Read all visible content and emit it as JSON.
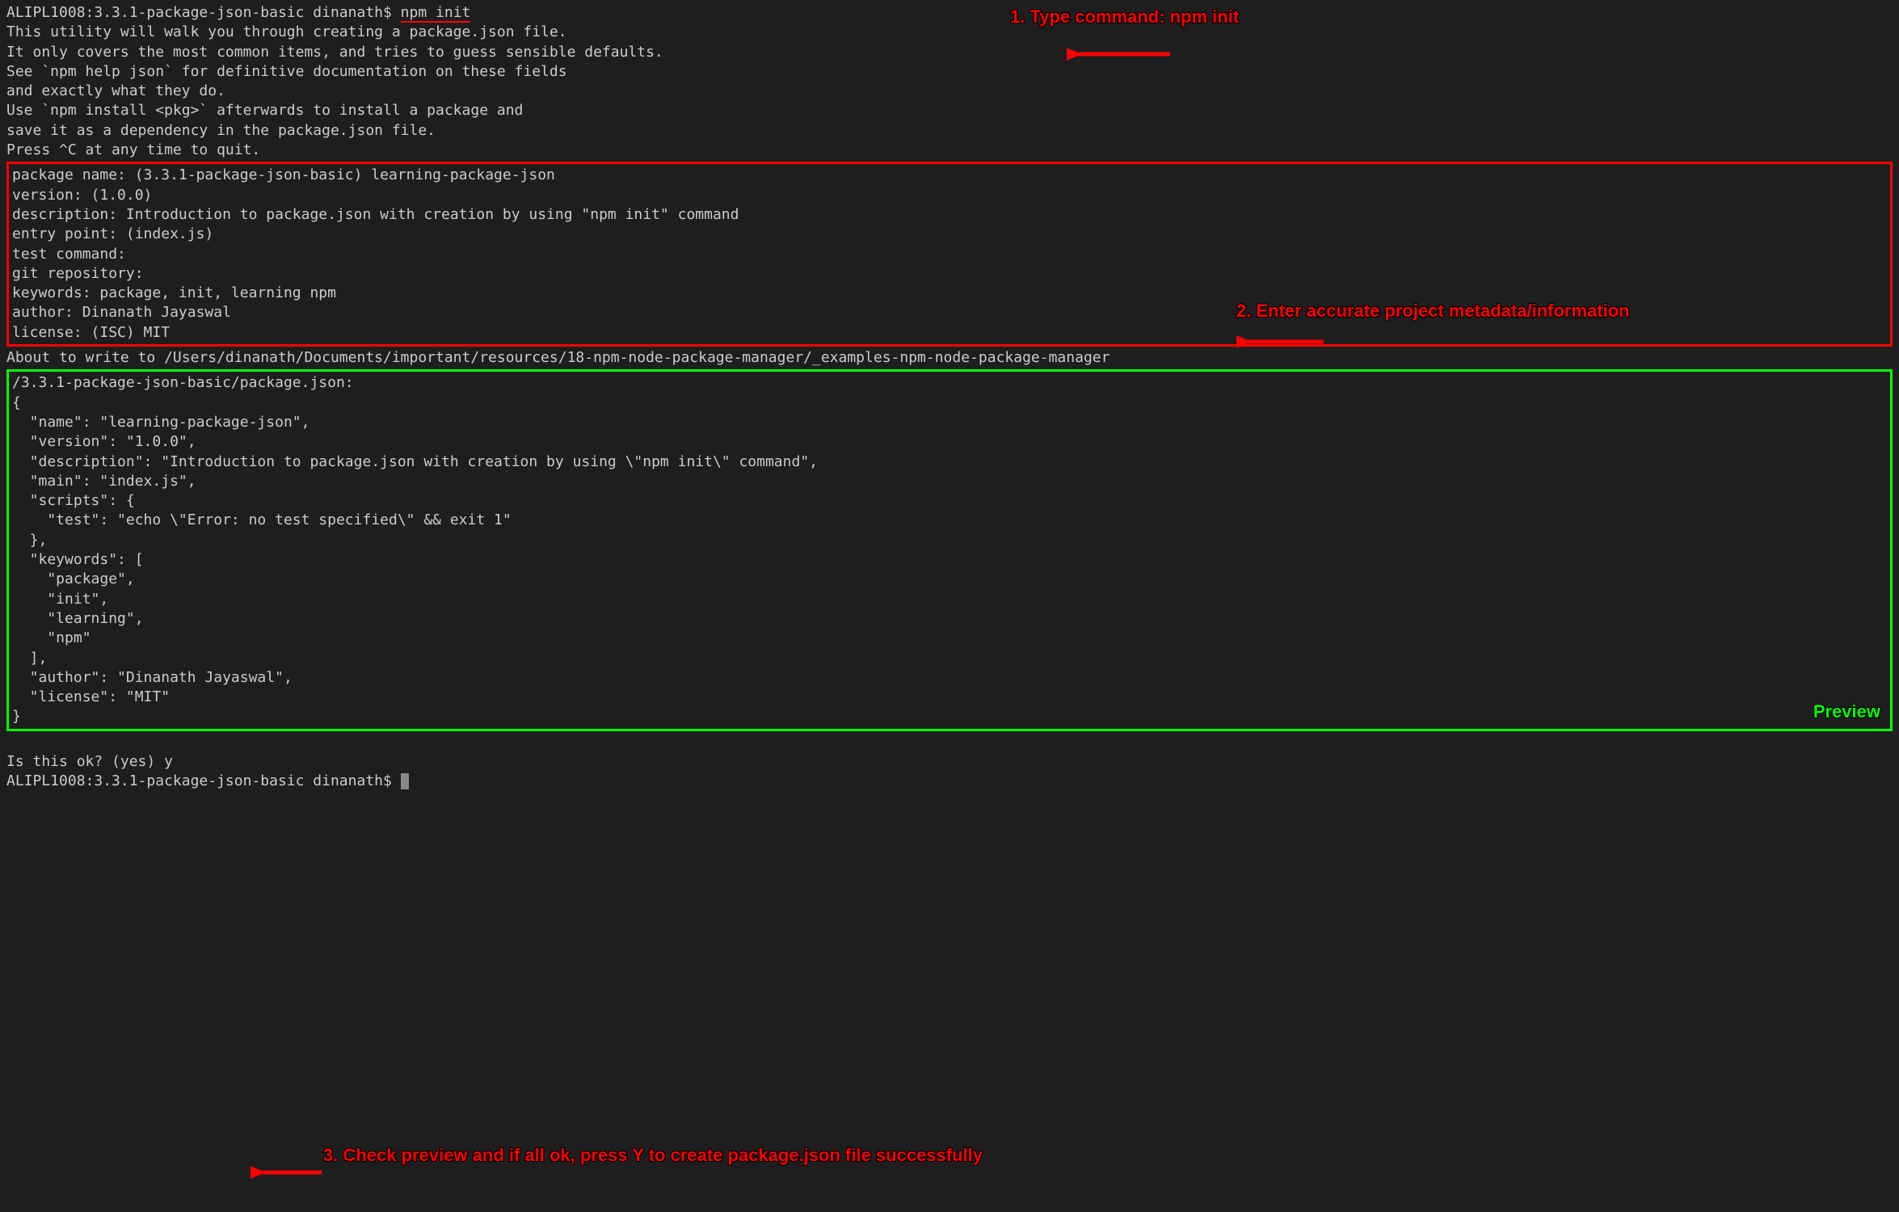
{
  "prompt": {
    "host": "ALIPL1008:3.3.1-package-json-basic dinanath$ ",
    "command": "npm init"
  },
  "intro": {
    "l1": "This utility will walk you through creating a package.json file.",
    "l2": "It only covers the most common items, and tries to guess sensible defaults.",
    "l3": "",
    "l4": "See `npm help json` for definitive documentation on these fields",
    "l5": "and exactly what they do.",
    "l6": "",
    "l7": "Use `npm install <pkg>` afterwards to install a package and",
    "l8": "save it as a dependency in the package.json file.",
    "l9": "",
    "l10": "Press ^C at any time to quit."
  },
  "meta": {
    "package_name": "package name: (3.3.1-package-json-basic) learning-package-json",
    "version": "version: (1.0.0) ",
    "description": "description: Introduction to package.json with creation by using \"npm init\" command",
    "entry_point": "entry point: (index.js) ",
    "test_command": "test command: ",
    "git_repository": "git repository: ",
    "keywords": "keywords: package, init, learning npm",
    "author": "author: Dinanath Jayaswal",
    "license": "license: (ISC) MIT"
  },
  "about_write": {
    "l1": "About to write to /Users/dinanath/Documents/important/resources/18-npm-node-package-manager/_examples-npm-node-package-manager",
    "l2": "/3.3.1-package-json-basic/package.json:"
  },
  "preview": {
    "l0": "",
    "l1": "{",
    "l2": "  \"name\": \"learning-package-json\",",
    "l3": "  \"version\": \"1.0.0\",",
    "l4": "  \"description\": \"Introduction to package.json with creation by using \\\"npm init\\\" command\",",
    "l5": "  \"main\": \"index.js\",",
    "l6": "  \"scripts\": {",
    "l7": "    \"test\": \"echo \\\"Error: no test specified\\\" && exit 1\"",
    "l8": "  },",
    "l9": "  \"keywords\": [",
    "l10": "    \"package\",",
    "l11": "    \"init\",",
    "l12": "    \"learning\",",
    "l13": "    \"npm\"",
    "l14": "  ],",
    "l15": "  \"author\": \"Dinanath Jayaswal\",",
    "l16": "  \"license\": \"MIT\"",
    "l17": "}"
  },
  "confirm": {
    "prompt": "Is this ok? (yes) y",
    "final_prompt": "ALIPL1008:3.3.1-package-json-basic dinanath$ "
  },
  "annotations": {
    "a1": "1. Type command:  npm init",
    "a2": "2. Enter accurate project metadata/information",
    "a3": "3. Check preview and if all ok, press Y  to create package.json file successfully",
    "preview_label": "Preview"
  },
  "colors": {
    "red": "#ff0000",
    "green": "#00ff00",
    "bg": "#1e1e1e",
    "text": "#cccccc"
  }
}
